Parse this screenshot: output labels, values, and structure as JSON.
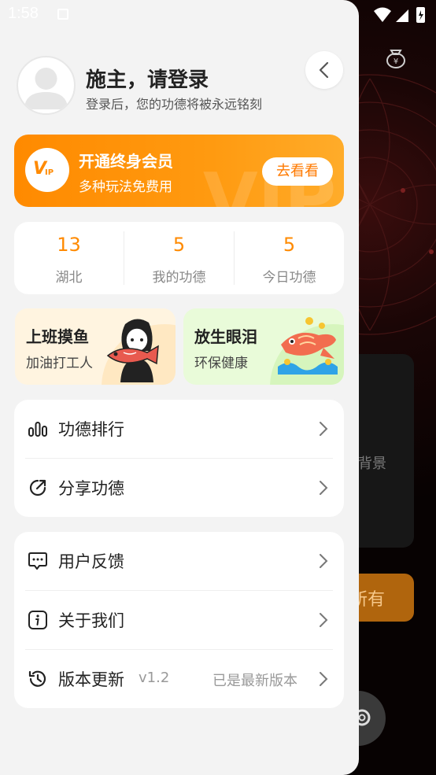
{
  "status_bar": {
    "time": "1:58"
  },
  "background": {
    "card_text": "背景",
    "button_text": "所有"
  },
  "header": {
    "title": "施主，请登录",
    "subtitle": "登录后，您的功德将被永远铭刻"
  },
  "vip": {
    "badge": "V",
    "badge_small": "IP",
    "title": "开通终身会员",
    "subtitle": "多种玩法免费用",
    "button": "去看看"
  },
  "stats": [
    {
      "value": "13",
      "label": "湖北"
    },
    {
      "value": "5",
      "label": "我的功德"
    },
    {
      "value": "5",
      "label": "今日功德"
    }
  ],
  "promos": [
    {
      "title": "上班摸鱼",
      "subtitle": "加油打工人"
    },
    {
      "title": "放生眼泪",
      "subtitle": "环保健康"
    }
  ],
  "menu_group_1": [
    {
      "label": "功德排行",
      "icon": "bar-chart-icon"
    },
    {
      "label": "分享功德",
      "icon": "share-icon"
    }
  ],
  "menu_group_2": [
    {
      "label": "用户反馈",
      "icon": "feedback-icon"
    },
    {
      "label": "关于我们",
      "icon": "info-icon"
    },
    {
      "label": "版本更新",
      "icon": "history-icon",
      "version": "v1.2",
      "status": "已是最新版本"
    }
  ],
  "colors": {
    "accent": "#ff8a00",
    "drawer_bg": "#f3f3f3"
  }
}
